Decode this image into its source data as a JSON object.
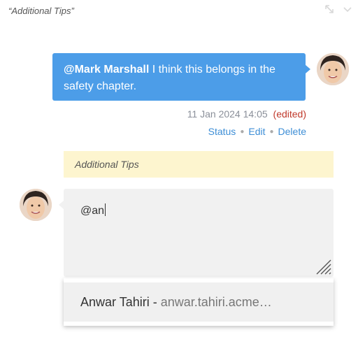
{
  "header": {
    "title": "“Additional Tips”"
  },
  "comment": {
    "mention": "@Mark Marshall",
    "text": " I think this belongs in the safety chapter.",
    "timestamp": "11 Jan 2024 14:05",
    "edited": "(edited)",
    "actions": {
      "status": "Status",
      "edit": "Edit",
      "delete": "Delete"
    }
  },
  "reference": {
    "text": "Additional Tips"
  },
  "compose": {
    "value": "@an"
  },
  "suggestion": {
    "name": "Anwar Tahiri",
    "separator": " - ",
    "email": "anwar.tahiri.acme…"
  },
  "colors": {
    "bubble": "#4c9de8",
    "link": "#3d8ed6",
    "edited": "#c0392b",
    "reference_bg": "#fdf5cf",
    "compose_bg": "#f1f1f1"
  }
}
